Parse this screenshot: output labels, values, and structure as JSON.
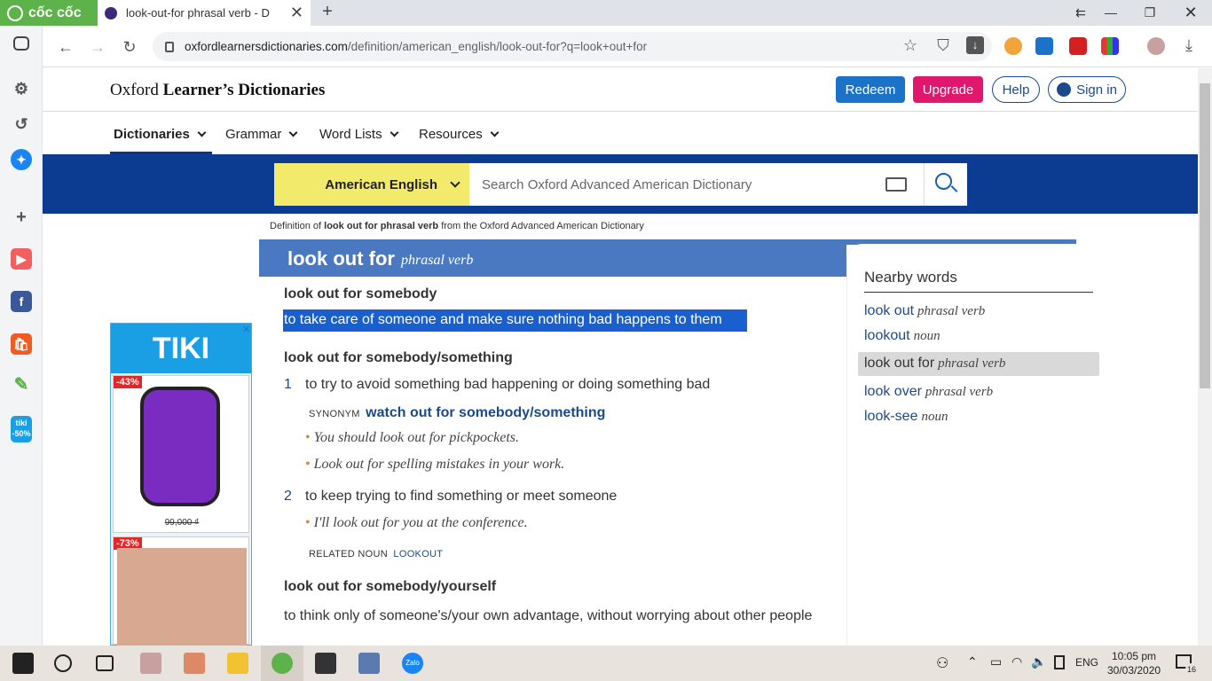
{
  "browser": {
    "brand": "cốc cốc",
    "tab_title": "look-out-for phrasal verb - D",
    "url_host": "oxfordlearnersdictionaries.com",
    "url_path": "/definition/american_english/look-out-for?q=look+out+for"
  },
  "site": {
    "logo_prefix": "Oxford",
    "logo_bold": "Learner’s Dictionaries",
    "redeem": "Redeem",
    "upgrade": "Upgrade",
    "help": "Help",
    "signin": "Sign in",
    "menu": [
      "Dictionaries",
      "Grammar",
      "Word Lists",
      "Resources"
    ],
    "language": "American English",
    "search_placeholder": "Search Oxford Advanced American Dictionary"
  },
  "entry": {
    "source_prefix": "Definition of",
    "source_bold": "look out for phrasal verb",
    "source_suffix": "from the Oxford Advanced American Dictionary",
    "headword": "look out for",
    "pos": "phrasal verb",
    "sense1_phrase": "look out for somebody",
    "sense1_def": "to take care of someone and make sure nothing bad happens to them",
    "sense2_phrase": "look out for somebody/something",
    "sense2_1_num": "1",
    "sense2_1_def": "to try to avoid something bad happening or doing something bad",
    "synonym_label": "SYNONYM",
    "synonym_link": "watch out for somebody/something",
    "ex1": "You should look out for pickpockets.",
    "ex2": "Look out for spelling mistakes in your work.",
    "sense2_2_num": "2",
    "sense2_2_def": "to keep trying to find something or meet someone",
    "ex3": "I'll look out for you at the conference.",
    "related_label": "RELATED NOUN",
    "related_link": "LOOKOUT",
    "sense3_phrase": "look out for somebody/yourself",
    "sense3_def": "to think only of someone's/your own advantage, without worrying about other people"
  },
  "nearby": {
    "title": "Nearby words",
    "items": [
      {
        "word": "look out",
        "pos": "phrasal verb"
      },
      {
        "word": "lookout",
        "pos": "noun"
      },
      {
        "word": "look out for",
        "pos": "phrasal verb"
      },
      {
        "word": "look over",
        "pos": "phrasal verb"
      },
      {
        "word": "look-see",
        "pos": "noun"
      }
    ]
  },
  "ad": {
    "brand": "TIKI",
    "badge1": "-43%",
    "price1": "99,000 ₫",
    "badge2": "-73%"
  },
  "rail": {
    "tiki_badge_top": "tiki",
    "tiki_badge_bottom": "-50%"
  },
  "taskbar": {
    "lang": "ENG",
    "time": "10:05 pm",
    "date": "30/03/2020",
    "notif_count": "16",
    "zalo": "Zalo"
  }
}
